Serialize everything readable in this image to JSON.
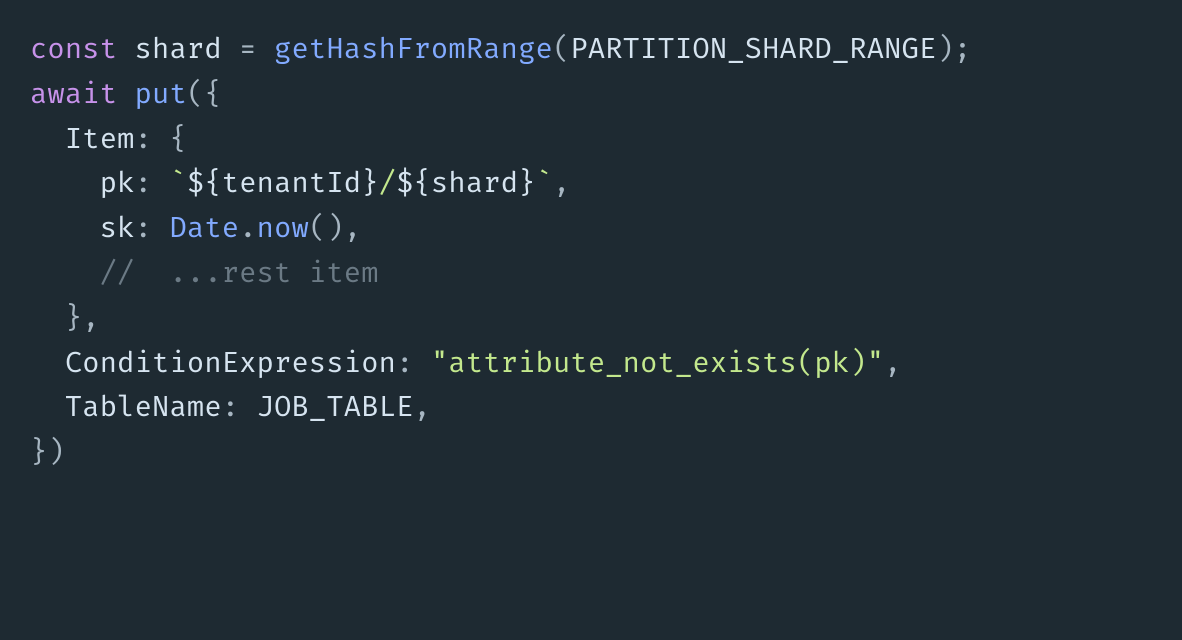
{
  "code": {
    "line1": {
      "kw_const": "const",
      "var_shard": "shard",
      "eq": " = ",
      "fn_getHash": "getHashFromRange",
      "lp": "(",
      "const_range": "PARTITION_SHARD_RANGE",
      "rp_semi": ");"
    },
    "line2": {
      "kw_await": "await",
      "sp": " ",
      "fn_put": "put",
      "open": "({"
    },
    "line3": {
      "prop_item": "Item",
      "colon_brace": ": {"
    },
    "line4": {
      "prop_pk": "pk",
      "colon_sp": ": ",
      "backtick_open": "`",
      "interp_open1": "${",
      "var_tenant": "tenantId",
      "interp_close1": "}",
      "slash": "/",
      "interp_open2": "${",
      "var_shard2": "shard",
      "interp_close2": "}",
      "backtick_close": "`",
      "comma": ","
    },
    "line5": {
      "prop_sk": "sk",
      "colon_sp": ": ",
      "global_date": "Date",
      "dot": ".",
      "fn_now": "now",
      "parens_comma": "(),"
    },
    "line6": {
      "comment": "//  ...rest item"
    },
    "line7": {
      "close": "},"
    },
    "line8": {
      "prop_cond": "ConditionExpression",
      "colon_sp": ": ",
      "q_open": "\"",
      "str_body": "attribute_not_exists(pk)",
      "q_close": "\"",
      "comma": ","
    },
    "line9": {
      "prop_table": "TableName",
      "colon_sp": ": ",
      "const_jobtable": "JOB_TABLE",
      "comma": ","
    },
    "line10": {
      "close": "})"
    }
  }
}
